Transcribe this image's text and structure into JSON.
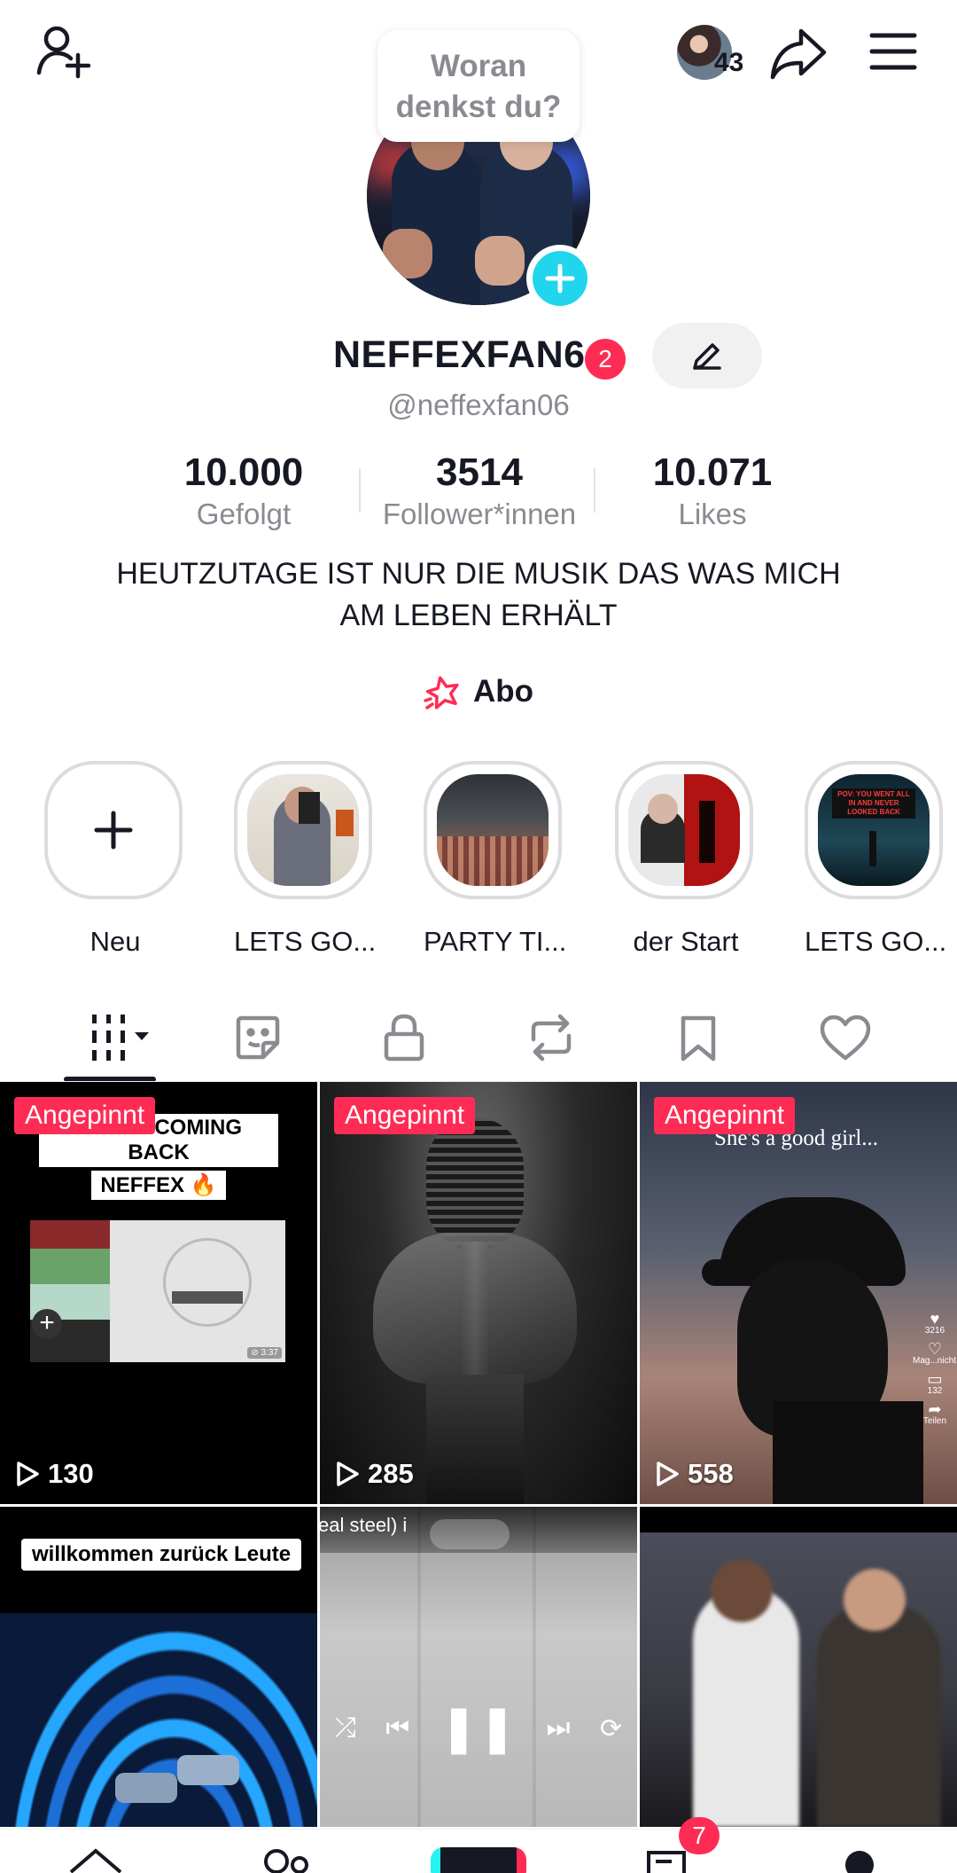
{
  "header": {
    "friends_count": "43",
    "story_prompt_line1": "Woran",
    "story_prompt_line2": "denkst du?"
  },
  "profile": {
    "display_name": "NEFFEXFAN6",
    "name_badge": "2",
    "handle": "@neffexfan06",
    "bio_line1": "HEUTZUTAGE IST NUR DIE MUSIK DAS WAS MICH",
    "bio_line2": "AM LEBEN ERHÄLT",
    "subscription_label": "Abo"
  },
  "stats": [
    {
      "value": "10.000",
      "label": "Gefolgt"
    },
    {
      "value": "3514",
      "label": "Follower*innen"
    },
    {
      "value": "10.071",
      "label": "Likes"
    }
  ],
  "highlights": [
    {
      "label": "Neu"
    },
    {
      "label": "LETS GO..."
    },
    {
      "label": "PARTY TI..."
    },
    {
      "label": "der Start"
    },
    {
      "label": "LETS GO..."
    }
  ],
  "highlight_overlay_text": "POV: YOU WENT ALL IN AND NEVER LOOKED BACK",
  "tabs": [
    {
      "icon": "grid-icon",
      "active": true
    },
    {
      "icon": "sticker-icon"
    },
    {
      "icon": "lock-icon"
    },
    {
      "icon": "repost-icon"
    },
    {
      "icon": "bookmark-icon"
    },
    {
      "icon": "heart-icon"
    }
  ],
  "videos": [
    {
      "pinned": "Angepinnt",
      "views": "130",
      "caption1": "NEVER COMING BACK",
      "caption2": "NEFFEX 🔥",
      "mini_label": "⊘ 3:37"
    },
    {
      "pinned": "Angepinnt",
      "views": "285"
    },
    {
      "pinned": "Angepinnt",
      "views": "558",
      "caption1": "She's a good girl...",
      "side1": "3216",
      "side2": "Mag...nicht",
      "side3": "132",
      "side4": "Teilen"
    },
    {
      "caption1": "willkommen zurück Leute"
    },
    {
      "caption1": "eal steel) i"
    },
    {}
  ],
  "bottom_nav": {
    "inbox_badge": "7"
  },
  "colors": {
    "accent": "#fe2c55",
    "cyan": "#20d5ec",
    "text": "#161823",
    "muted": "#8a8b91"
  }
}
